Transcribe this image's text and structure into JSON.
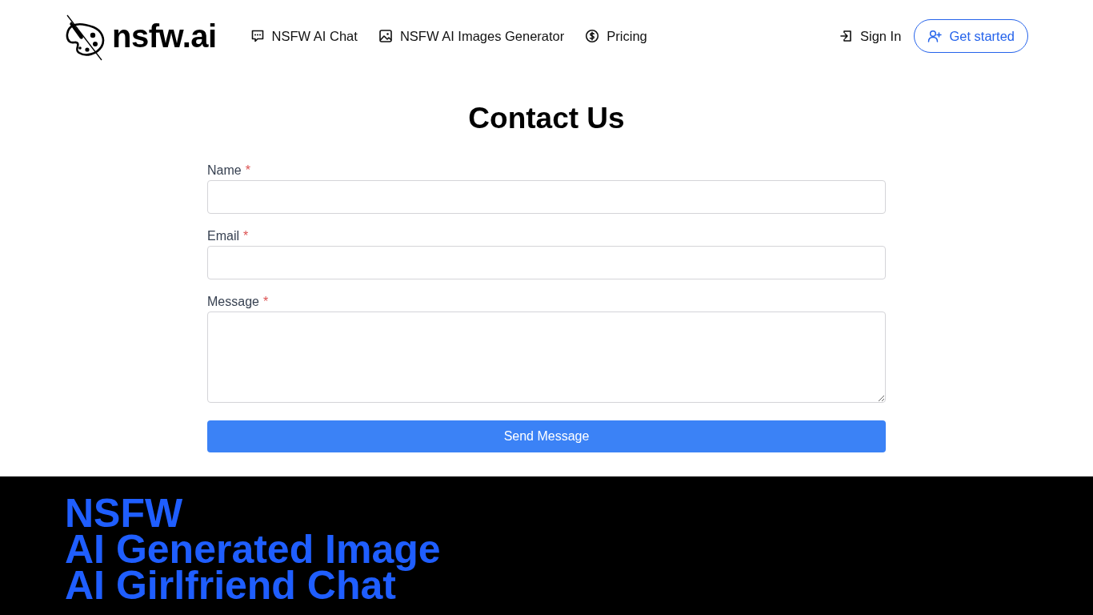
{
  "header": {
    "brand": "nsfw.ai",
    "nav_links": [
      {
        "label": "NSFW AI Chat"
      },
      {
        "label": "NSFW AI Images Generator"
      },
      {
        "label": "Pricing"
      }
    ],
    "sign_in": "Sign In",
    "get_started": "Get started"
  },
  "contact_form": {
    "title": "Contact Us",
    "fields": [
      {
        "label": "Name",
        "required_mark": "*",
        "kind": "input"
      },
      {
        "label": "Email",
        "required_mark": "*",
        "kind": "input"
      },
      {
        "label": "Message",
        "required_mark": "*",
        "kind": "textarea"
      }
    ],
    "submit": "Send Message"
  },
  "footer": {
    "headline_lines": [
      "NSFW",
      "AI Generated Image",
      "AI Girlfriend Chat"
    ]
  }
}
